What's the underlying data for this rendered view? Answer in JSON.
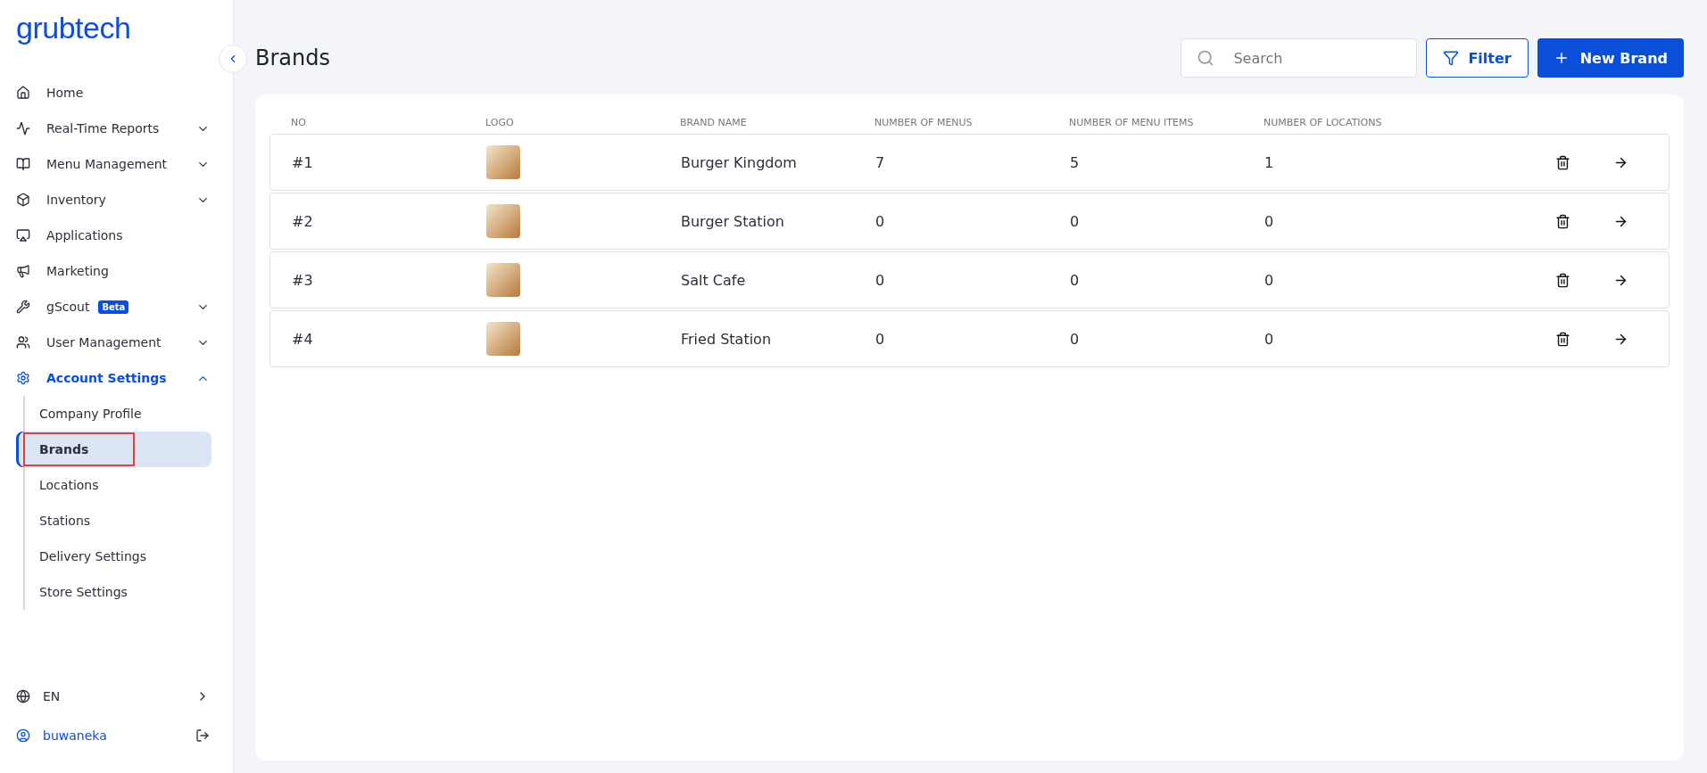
{
  "sidebar": {
    "logo": "grubtech",
    "items": [
      {
        "label": "Home"
      },
      {
        "label": "Real-Time Reports",
        "expanded": false
      },
      {
        "label": "Menu Management",
        "expanded": false
      },
      {
        "label": "Inventory",
        "expanded": false
      },
      {
        "label": "Applications"
      },
      {
        "label": "Marketing"
      },
      {
        "label": "gScout",
        "badge": "Beta",
        "expanded": false
      },
      {
        "label": "User Management",
        "expanded": false
      },
      {
        "label": "Account Settings",
        "expanded": true,
        "selected": true,
        "children": [
          {
            "label": "Company Profile",
            "selected": false,
            "outlined": false
          },
          {
            "label": "Brands",
            "selected": true,
            "outlined": true
          },
          {
            "label": "Locations",
            "selected": false,
            "outlined": false
          },
          {
            "label": "Stations",
            "selected": false,
            "outlined": false
          },
          {
            "label": "Delivery Settings",
            "selected": false,
            "outlined": false
          },
          {
            "label": "Store Settings",
            "selected": false,
            "outlined": false
          }
        ]
      }
    ],
    "language": "EN",
    "user": "buwaneka"
  },
  "page": {
    "title": "Brands",
    "search": {
      "placeholder": "Search"
    },
    "filter_button": "Filter",
    "new_button": "New Brand"
  },
  "table": {
    "columns": [
      "NO",
      "LOGO",
      "BRAND NAME",
      "NUMBER OF MENUS",
      "NUMBER OF MENU ITEMS",
      "NUMBER OF LOCATIONS"
    ],
    "rows": [
      {
        "no": "#1",
        "name": "Burger Kingdom",
        "menus": "7",
        "menu_items": "5",
        "locations": "1"
      },
      {
        "no": "#2",
        "name": "Burger Station",
        "menus": "0",
        "menu_items": "0",
        "locations": "0"
      },
      {
        "no": "#3",
        "name": "Salt Cafe",
        "menus": "0",
        "menu_items": "0",
        "locations": "0"
      },
      {
        "no": "#4",
        "name": "Fried Station",
        "menus": "0",
        "menu_items": "0",
        "locations": "0"
      }
    ]
  }
}
